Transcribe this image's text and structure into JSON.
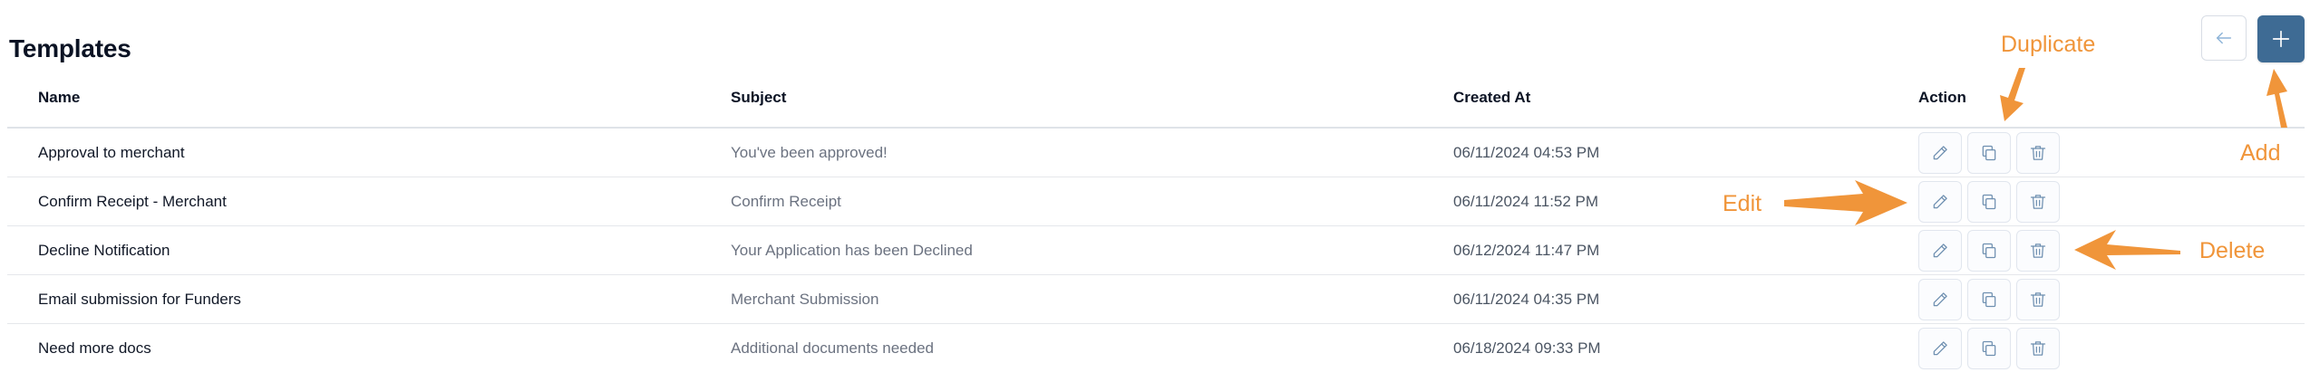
{
  "page": {
    "title": "Templates"
  },
  "toolbar": {
    "back_icon": "arrow-left-icon",
    "add_icon": "plus-icon"
  },
  "table": {
    "columns": [
      "Name",
      "Subject",
      "Created At",
      "Action"
    ],
    "rows": [
      {
        "name": "Approval to merchant",
        "subject": "You've been approved!",
        "created_at": "06/11/2024 04:53 PM"
      },
      {
        "name": "Confirm Receipt - Merchant",
        "subject": "Confirm Receipt",
        "created_at": "06/11/2024 11:52 PM"
      },
      {
        "name": "Decline Notification",
        "subject": "Your Application has been Declined",
        "created_at": "06/12/2024 11:47 PM"
      },
      {
        "name": "Email submission for Funders",
        "subject": "Merchant Submission",
        "created_at": "06/11/2024 04:35 PM"
      },
      {
        "name": "Need more docs",
        "subject": "Additional documents needed",
        "created_at": "06/18/2024 09:33 PM"
      }
    ],
    "action_icons": [
      "pencil-icon",
      "copy-icon",
      "trash-icon"
    ]
  },
  "annotations": {
    "duplicate": "Duplicate",
    "add": "Add",
    "edit": "Edit",
    "delete": "Delete",
    "color": "#f0953a"
  },
  "colors": {
    "primary": "#3e6b94",
    "icon": "#6e8fb0"
  }
}
